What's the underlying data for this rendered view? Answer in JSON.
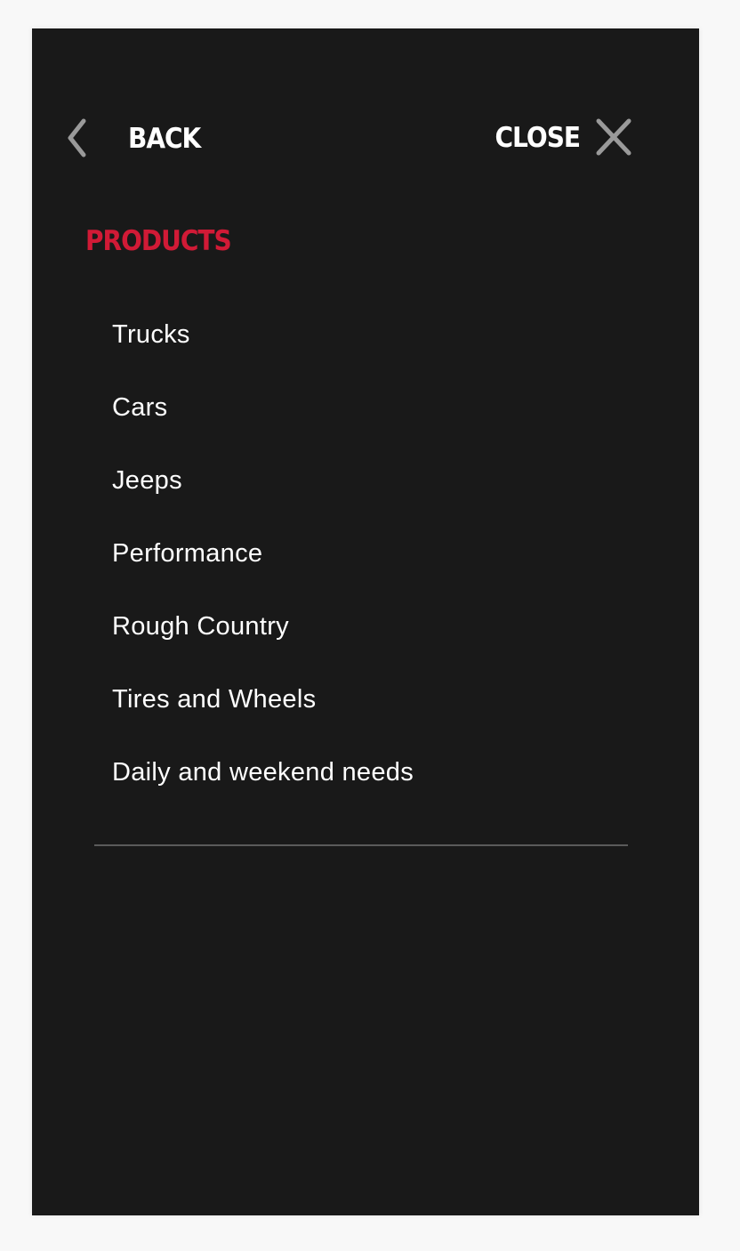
{
  "header": {
    "back_label": "BACK",
    "back_icon": "chevron-left-icon",
    "close_label": "CLOSE",
    "close_icon": "close-icon"
  },
  "section": {
    "title": "PRODUCTS"
  },
  "menu": {
    "items": [
      {
        "label": "Trucks"
      },
      {
        "label": "Cars"
      },
      {
        "label": "Jeeps"
      },
      {
        "label": "Performance"
      },
      {
        "label": "Rough Country"
      },
      {
        "label": "Tires and Wheels"
      },
      {
        "label": "Daily and weekend needs"
      }
    ]
  },
  "colors": {
    "panel_background": "#191919",
    "accent": "#d11a36",
    "text": "#ffffff",
    "icon": "#9a9a9a",
    "divider": "#5a5a5a"
  }
}
